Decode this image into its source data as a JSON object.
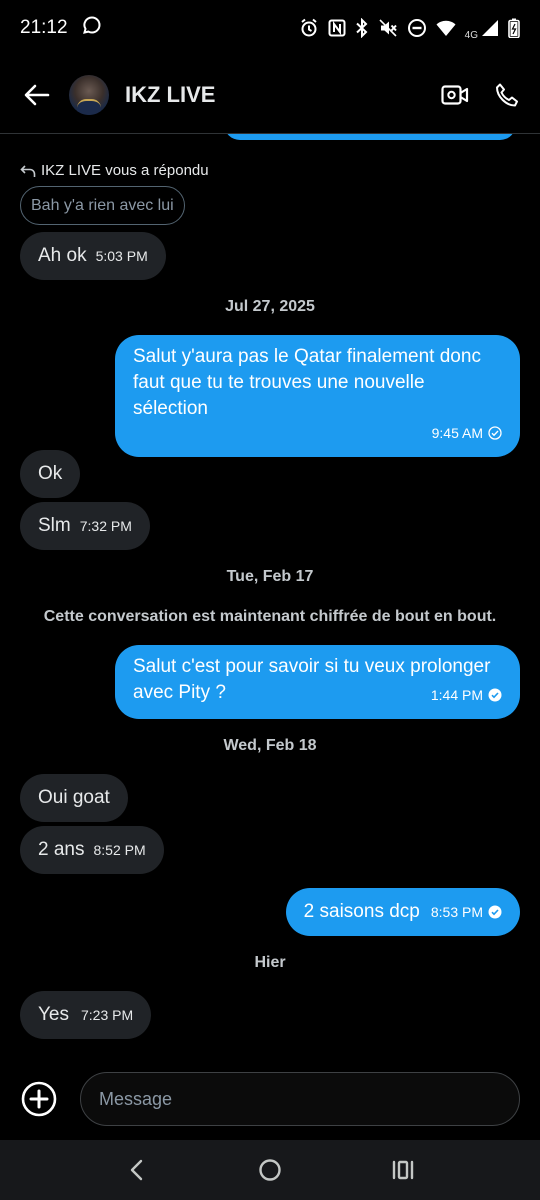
{
  "status_bar": {
    "time": "21:12",
    "network": "4G",
    "icons": [
      "chat-bubble-icon",
      "alarm-icon",
      "nfc-icon",
      "bluetooth-icon",
      "mute-icon",
      "dnd-icon",
      "wifi-icon",
      "signal-icon",
      "battery-icon"
    ]
  },
  "header": {
    "title": "IKZ LIVE",
    "icons": [
      "back-arrow-icon",
      "video-call-icon",
      "phone-icon"
    ]
  },
  "conversation": {
    "reply_indicator": "IKZ LIVE vous a répondu",
    "quoted_text": "Bah y'a rien avec lui",
    "messages": [
      {
        "text": "Ah ok",
        "time": "5:03 PM",
        "from": "them"
      },
      {
        "date": "Jul 27, 2025"
      },
      {
        "text": "Salut y'aura pas le Qatar finalement donc faut que tu te trouves une nouvelle sélection",
        "time": "9:45 AM",
        "from": "me",
        "status": "sent"
      },
      {
        "text": "Ok",
        "from": "them"
      },
      {
        "text": "Slm",
        "time": "7:32 PM",
        "from": "them"
      },
      {
        "date": "Tue, Feb 17"
      },
      {
        "system": "Cette conversation est maintenant chiffrée de bout en bout."
      },
      {
        "text": "Salut c'est pour savoir si tu veux prolonger avec Pity ?",
        "time": "1:44 PM",
        "from": "me",
        "status": "read"
      },
      {
        "date": "Wed, Feb 18"
      },
      {
        "text": "Oui goat",
        "from": "them"
      },
      {
        "text": "2 ans",
        "time": "8:52 PM",
        "from": "them"
      },
      {
        "text": "2 saisons dcp",
        "time": "8:53 PM",
        "from": "me",
        "status": "read"
      },
      {
        "date": "Hier"
      },
      {
        "text": "Yes",
        "time": "7:23 PM",
        "from": "them"
      }
    ]
  },
  "composer": {
    "placeholder": "Message"
  },
  "colors": {
    "background": "#000000",
    "outgoing_bubble": "#1d9bf0",
    "incoming_bubble": "#202327"
  }
}
